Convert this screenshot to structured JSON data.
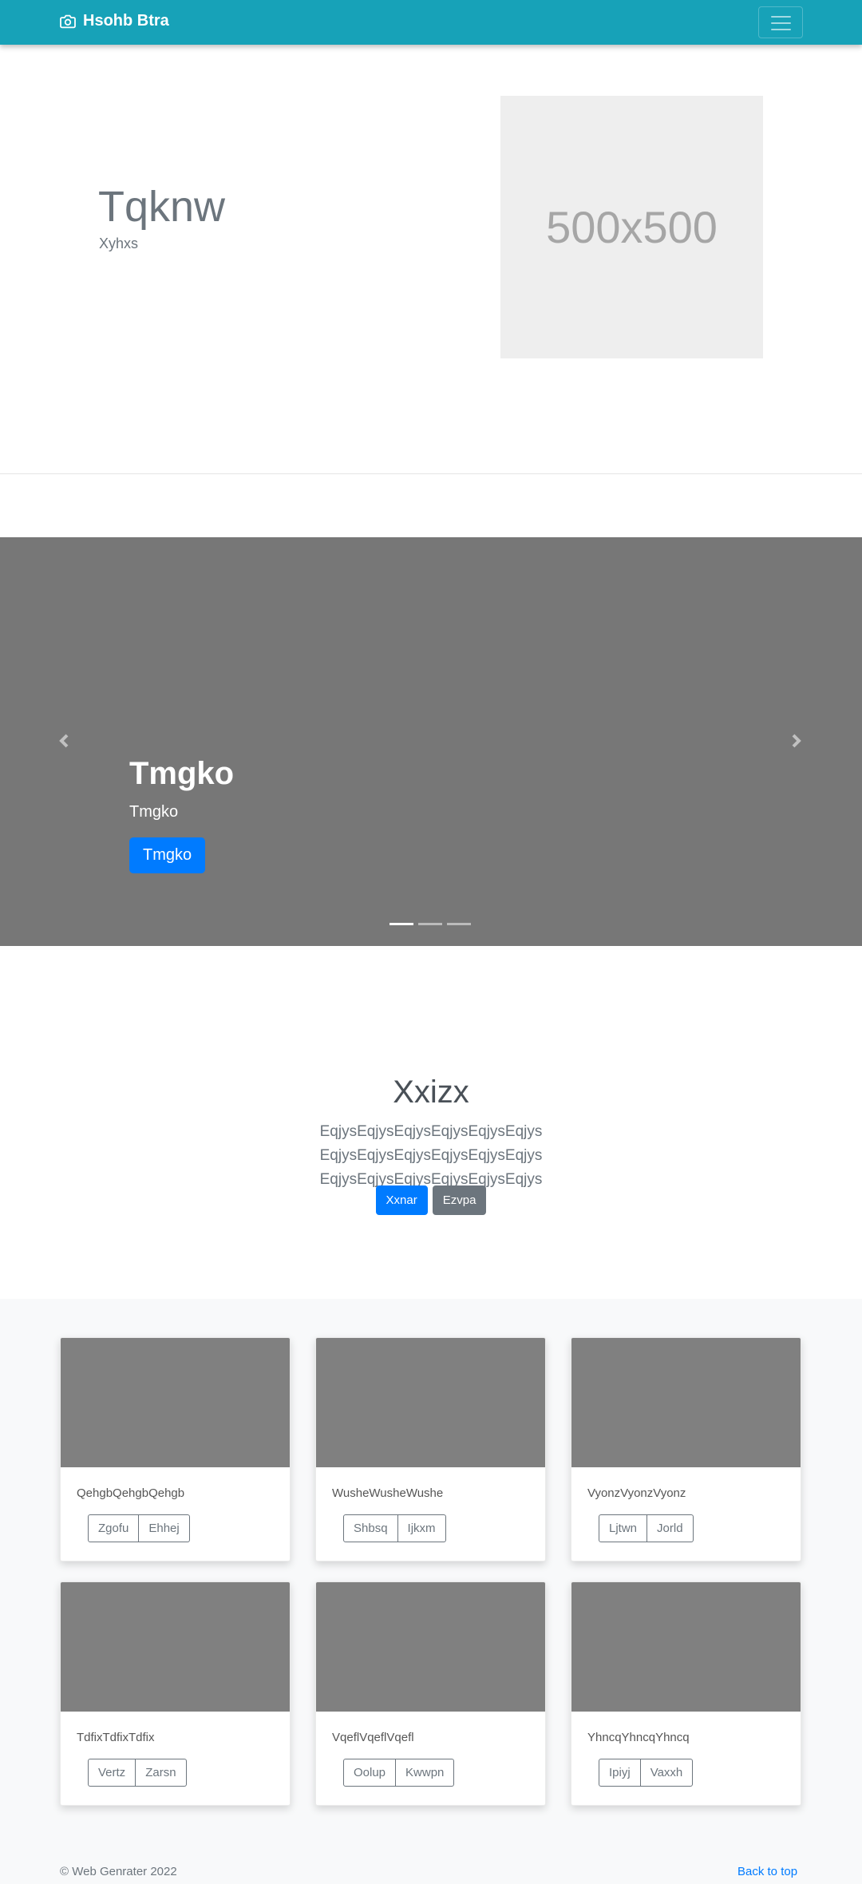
{
  "navbar": {
    "brand": "Hsohb Btra",
    "brand_icon": "camera-icon",
    "toggler_icon": "hamburger-icon"
  },
  "hero": {
    "title": "Tqknw",
    "subtitle": "Xyhxs",
    "image_placeholder": "500x500"
  },
  "carousel": {
    "title": "Tmgko",
    "text": "Tmgko",
    "button": "Tmgko",
    "active_slide": 1,
    "slide_count": 3
  },
  "section": {
    "title": "Xxizx",
    "lead": "EqjysEqjysEqjysEqjysEqjysEqjys EqjysEqjysEqjysEqjysEqjysEqjys EqjysEqjysEqjysEqjysEqjysEqjys",
    "primary_button": "Xxnar",
    "secondary_button": "Ezvpa"
  },
  "cards": [
    {
      "text": "QehgbQehgbQehgb",
      "btn1": "Zgofu",
      "btn2": "Ehhej"
    },
    {
      "text": "WusheWusheWushe",
      "btn1": "Shbsq",
      "btn2": "Ijkxm"
    },
    {
      "text": "VyonzVyonzVyonz",
      "btn1": "Ljtwn",
      "btn2": "Jorld"
    },
    {
      "text": "TdfixTdfixTdfix",
      "btn1": "Vertz",
      "btn2": "Zarsn"
    },
    {
      "text": "VqeflVqeflVqefl",
      "btn1": "Oolup",
      "btn2": "Kwwpn"
    },
    {
      "text": "YhncqYhncqYhncq",
      "btn1": "Ipiyj",
      "btn2": "Vaxxh"
    }
  ],
  "footer": {
    "copyright": "© Web Genrater 2022",
    "back_to_top": "Back to top"
  },
  "colors": {
    "navbar": "#17a2b8",
    "primary": "#007bff",
    "secondary": "#6c757d",
    "carousel_bg": "#777777"
  }
}
